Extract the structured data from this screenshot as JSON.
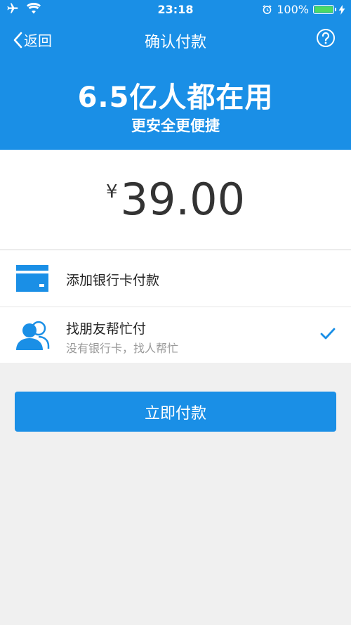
{
  "status_bar": {
    "time": "23:18",
    "battery_percent": "100%",
    "battery_level": 1.0
  },
  "nav": {
    "back_label": "返回",
    "title": "确认付款",
    "help_icon": "question-circle-icon"
  },
  "banner": {
    "title": "6.5亿人都在用",
    "subtitle": "更安全更便捷"
  },
  "payment": {
    "currency_symbol": "¥",
    "amount": "39.00"
  },
  "options": [
    {
      "label": "添加银行卡付款",
      "icon": "bank-card-icon"
    },
    {
      "label": "找朋友帮忙付",
      "sublabel": "没有银行卡，找人帮忙",
      "icon": "friends-icon",
      "selected": true
    }
  ],
  "pay_button": {
    "label": "立即付款"
  },
  "colors": {
    "primary": "#1a8fe6",
    "background": "#f0f0f0",
    "text_dark": "#222222",
    "text_muted": "#999999"
  }
}
